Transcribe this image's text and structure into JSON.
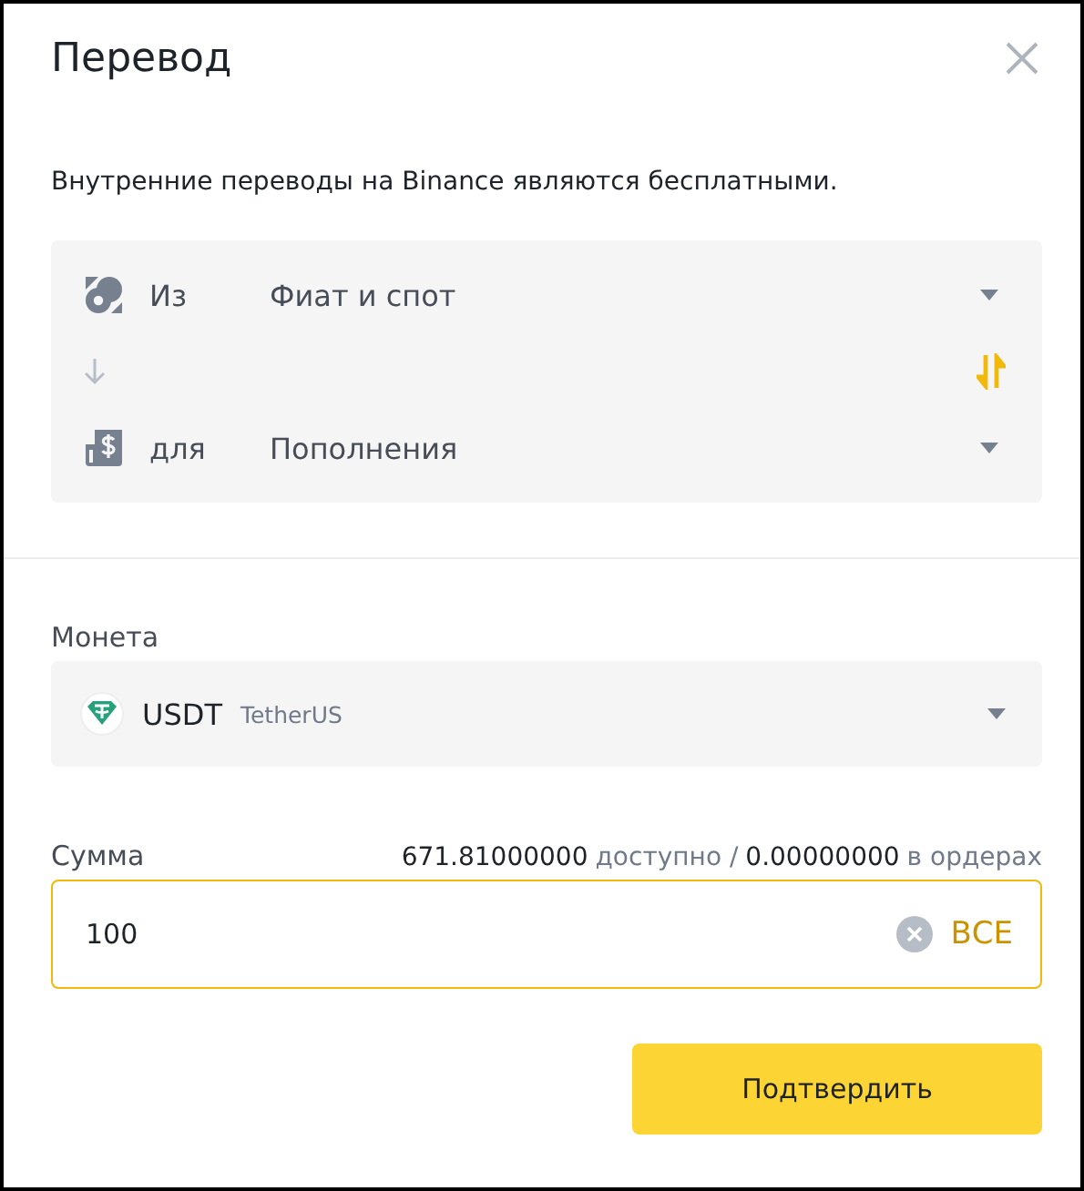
{
  "title": "Перевод",
  "notice": "Внутренние переводы на Binance являются бесплатными.",
  "wallets": [
    {
      "kind": "from",
      "label": "Из",
      "value": "Фиат и спот"
    },
    {
      "kind": "to",
      "label": "для",
      "value": "Пополнения"
    }
  ],
  "coin": {
    "label": "Монета",
    "symbol": "USDT",
    "name": "TetherUS"
  },
  "amount": {
    "label": "Сумма",
    "available": "671.81000000",
    "available_label": "доступно /",
    "in_orders": "0.00000000",
    "in_orders_label": "в ордерах",
    "value": "100",
    "max": "ВСЕ"
  },
  "confirm": "Подтвердить"
}
